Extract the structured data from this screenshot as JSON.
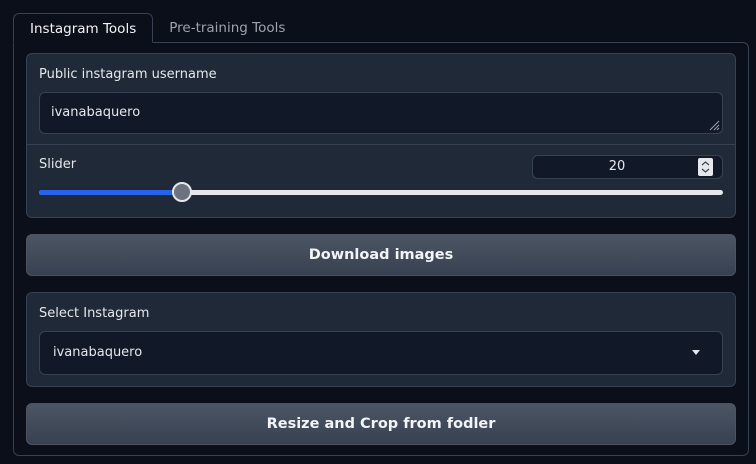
{
  "tabs": [
    {
      "label": "Instagram Tools",
      "active": true
    },
    {
      "label": "Pre-training Tools",
      "active": false
    }
  ],
  "username": {
    "label": "Public instagram username",
    "value": "ivanabaquero"
  },
  "slider": {
    "label": "Slider",
    "value": "20",
    "fraction": 0.209
  },
  "download_button": {
    "label": "Download images"
  },
  "select": {
    "label": "Select Instagram",
    "value": "ivanabaquero"
  },
  "resize_button": {
    "label": "Resize and Crop from fodler"
  },
  "colors": {
    "accent": "#2563eb",
    "background": "#0b0f19",
    "panel": "#1f2937"
  }
}
